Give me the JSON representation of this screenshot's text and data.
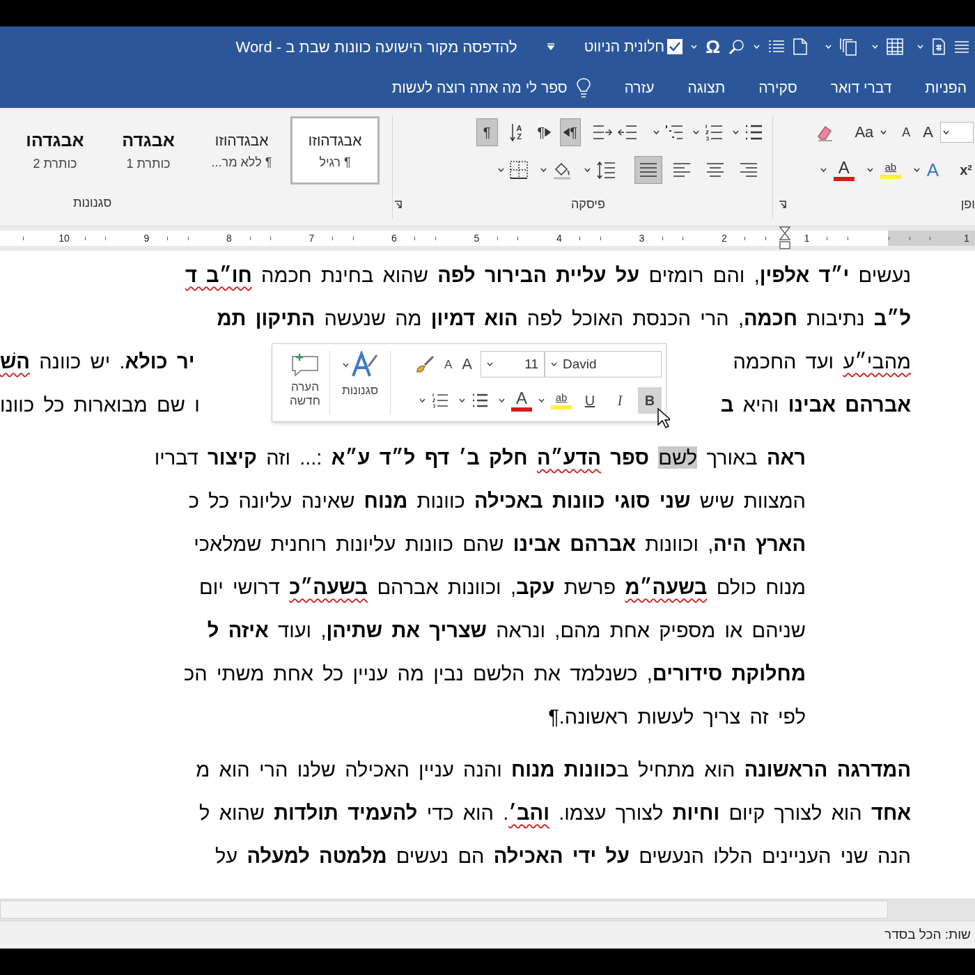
{
  "title_bar": {
    "title": "להדפסה מקור הישועה כוונות שבת ב - Word",
    "symbol_button": "Ω",
    "nav_pane": {
      "label": "חלונית הניווט",
      "checked": true
    }
  },
  "tabs": [
    {
      "label": "הפניות"
    },
    {
      "label": "דברי דואר"
    },
    {
      "label": "סקירה"
    },
    {
      "label": "תצוגה"
    },
    {
      "label": "עזרה"
    }
  ],
  "tell_me": {
    "placeholder": "ספר לי מה אתה רוצה לעשות"
  },
  "ribbon": {
    "font_group": {
      "label": "ופן",
      "grow_label": "A",
      "shrink_label": "A",
      "case_label": "Aa",
      "superscript_label": "x²",
      "effects_label": "A",
      "highlight_label": "ab",
      "font_color_label": "A"
    },
    "paragraph_group": {
      "label": "פיסקה",
      "sort_label": "AZ",
      "show_marks": {
        "label": "¶",
        "pressed": true
      },
      "rtl": {
        "label": "¶",
        "pressed": true
      },
      "ltr": {
        "label": "¶",
        "pressed": false
      },
      "alignment": [
        {
          "kind": "right",
          "pressed": false
        },
        {
          "kind": "center",
          "pressed": false
        },
        {
          "kind": "left",
          "pressed": false
        },
        {
          "kind": "justify",
          "pressed": true
        }
      ]
    },
    "styles_group": {
      "label": "סגנונות",
      "styles": [
        {
          "kind": "normal",
          "sample": "אבגדהוזו",
          "name": "¶ רגיל",
          "selected": true
        },
        {
          "kind": "normal",
          "sample": "אבגדהוזו",
          "name": "¶ ללא מר...",
          "selected": false
        },
        {
          "kind": "heading",
          "sample": "אבגדה",
          "name": "כותרת 1",
          "selected": false
        },
        {
          "kind": "heading",
          "sample": "אבגדהו",
          "name": "כותרת 2",
          "selected": false
        }
      ]
    }
  },
  "ruler": {
    "numbers": [
      "1",
      "1",
      "2",
      "3",
      "4",
      "5",
      "6",
      "7",
      "8",
      "9",
      "10"
    ]
  },
  "document": {
    "paragraphs": [
      {
        "indented": false,
        "lines": [
          {
            "runs": [
              {
                "kind": "text",
                "text": "נעשים **י״ד אלפין**, והם רומזים **על עליית הבירור לפה** שהוא בחינת חכמה "
              },
              {
                "kind": "spelling-error",
                "text": "**חו״ב ד**"
              }
            ]
          },
          {
            "runs": [
              {
                "kind": "text",
                "text": "**ל״ב** נתיבות **חכמה**, הרי הכנסת האוכל לפה **הוא דמיון** מה שנעשה **התיקון תמ**"
              }
            ]
          },
          {
            "right": [
              {
                "kind": "spelling-error",
                "text": "מהבי״ע"
              },
              {
                "kind": "text",
                "text": " ועד החכמה"
              }
            ],
            "left": [
              {
                "kind": "text",
                "text": "**יר כולא**. יש כוונה "
              },
              {
                "kind": "spelling-error",
                "text": "**השׁ**"
              }
            ]
          },
          {
            "right": [
              {
                "kind": "text",
                "text": "**אברהם אבינו** והיא **ב**"
              }
            ],
            "left": [
              {
                "kind": "text",
                "text": "ו שם מבוארות כל כוונו"
              }
            ]
          }
        ]
      },
      {
        "indented": true,
        "lines": [
          {
            "runs": [
              {
                "kind": "text",
                "text": "**ראה** באורך "
              },
              {
                "kind": "selection",
                "text": "לשם"
              },
              {
                "kind": "text",
                "text": " **ספר** "
              },
              {
                "kind": "spelling-error",
                "text": "**הדע״ה**"
              },
              {
                "kind": "text",
                "text": " **חלק ב׳ דף ל״ד ע״א** :... וזה **קיצור** דבריו"
              }
            ]
          },
          {
            "runs": [
              {
                "kind": "text",
                "text": "המצוות שיש **שני סוגי כוונות באכילה** כוונות **מנוח** שאינה עליונה כל כ"
              }
            ]
          },
          {
            "runs": [
              {
                "kind": "text",
                "text": "**הארץ היה**, וכוונות **אברהם אבינו** שהם כוונות עליונות רוחנית שמלאכי"
              }
            ]
          },
          {
            "runs": [
              {
                "kind": "text",
                "text": "מנוח כולם "
              },
              {
                "kind": "spelling-error",
                "text": "**בשעה״מ**"
              },
              {
                "kind": "text",
                "text": " פרשת **עקב**, וכוונות אברהם "
              },
              {
                "kind": "spelling-error",
                "text": "**בשעה״כ**"
              },
              {
                "kind": "text",
                "text": " דרושי יום"
              }
            ]
          },
          {
            "runs": [
              {
                "kind": "text",
                "text": "שניהם או מספיק אחת מהם, ונראה **שצריך את שתיהן**, ועוד **איזה ל**"
              }
            ]
          },
          {
            "runs": [
              {
                "kind": "text",
                "text": "**מחלוקת סידורים**, כשנלמד את הלשם נבין מה עניין כל אחת משתי הכ"
              }
            ]
          },
          {
            "runs": [
              {
                "kind": "text",
                "text": "לפי זה צריך לעשות ראשונה.¶"
              }
            ]
          }
        ]
      },
      {
        "indented": false,
        "lines": [
          {
            "runs": [
              {
                "kind": "text",
                "text": "**המדרגה הראשונה** הוא מתחיל ב**כוונות מנוח** והנה עניין האכילה שלנו הרי הוא מ"
              }
            ]
          },
          {
            "runs": [
              {
                "kind": "text",
                "text": "**אחד** הוא לצורך קיום **וחיות** לצורך עצמו. "
              },
              {
                "kind": "spelling-error",
                "text": "**והב׳**"
              },
              {
                "kind": "text",
                "text": ". הוא כדי **להעמיד תולדות** שהוא ל"
              }
            ]
          },
          {
            "runs": [
              {
                "kind": "text",
                "text": "הנה שני העניינים הללו הנעשים **על ידי האכילה** הם נעשים **מלמטה למעלה** על"
              }
            ]
          }
        ]
      }
    ]
  },
  "mini_toolbar": {
    "font": "David",
    "size": "11",
    "grow_label": "A",
    "shrink_label": "A",
    "styles_label": "סגנונות",
    "comment_label": "הערה חדשה",
    "highlight_label": "ab",
    "font_color_label": "A",
    "format_buttons": [
      {
        "kind": "bold",
        "label": "B",
        "hovered": true
      },
      {
        "kind": "italic",
        "label": "I",
        "hovered": false
      },
      {
        "kind": "underline",
        "label": "U",
        "hovered": false
      }
    ]
  },
  "status_bar": {
    "text": "שות: הכל בסדר"
  }
}
